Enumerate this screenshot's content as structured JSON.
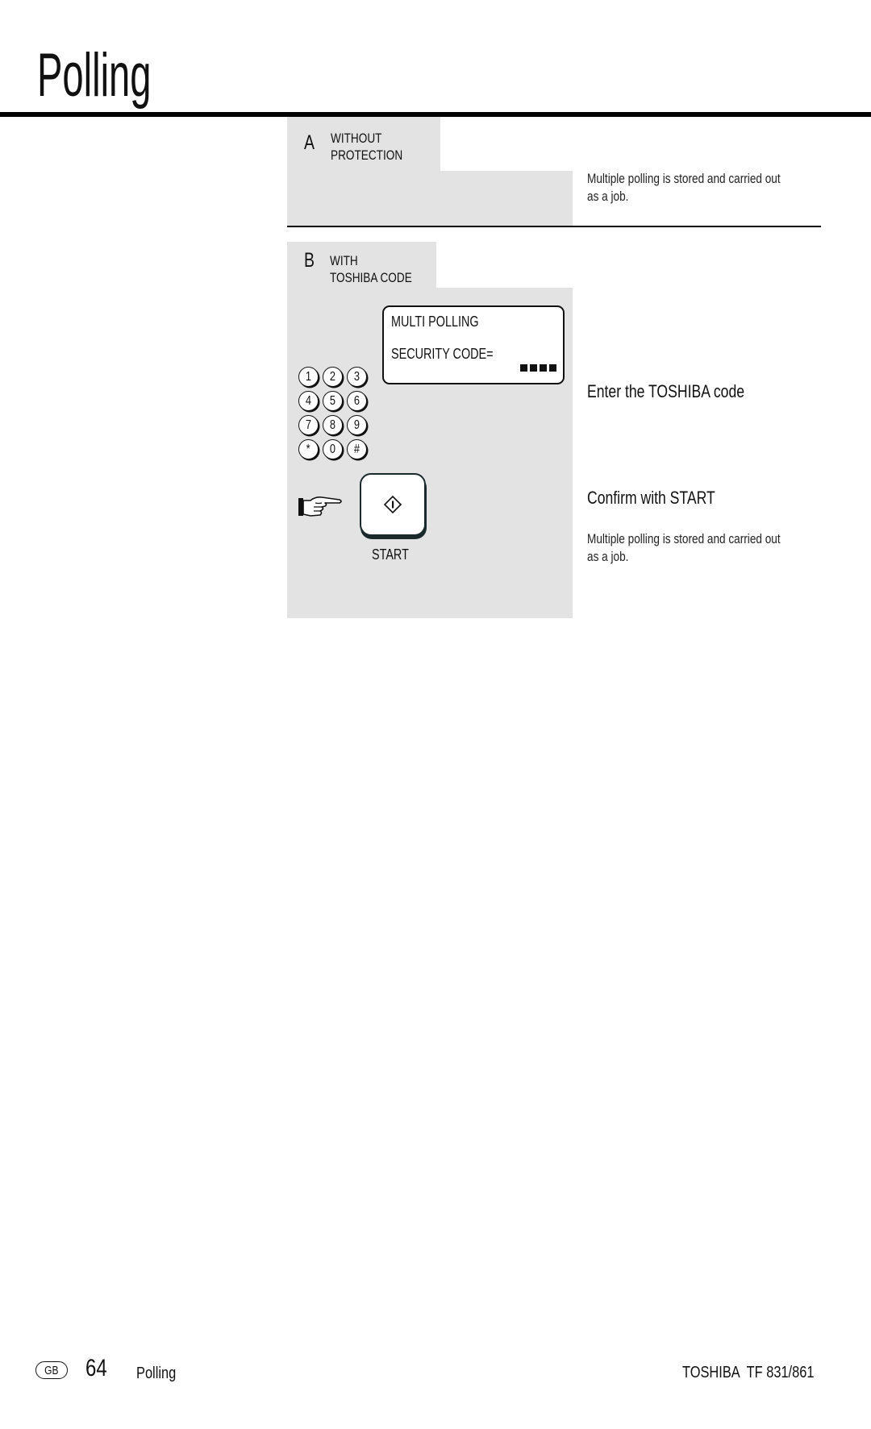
{
  "page": {
    "title": "Polling"
  },
  "section_a": {
    "letter": "A",
    "label_line1": "WITHOUT",
    "label_line2": "PROTECTION",
    "note": [
      "Multiple polling is stored and carried out",
      "as a job."
    ]
  },
  "section_b": {
    "letter": "B",
    "label_line1": "WITH",
    "label_line2": "TOSHIBA CODE",
    "display": {
      "line1": "MULTI POLLING",
      "line2": "SECURITY CODE=",
      "masked_code_blocks": 4
    },
    "keypad": [
      "1",
      "2",
      "3",
      "4",
      "5",
      "6",
      "7",
      "8",
      "9",
      "*",
      "0",
      "#"
    ],
    "start_button_label": "START",
    "step1": "Enter the TOSHIBA code",
    "step2": "Confirm with START",
    "note": [
      "Multiple polling is stored and carried out",
      "as a job."
    ]
  },
  "footer": {
    "region_badge": "GB",
    "page_number": "64",
    "section": "Polling",
    "product": "TOSHIBA  TF 831/861"
  }
}
